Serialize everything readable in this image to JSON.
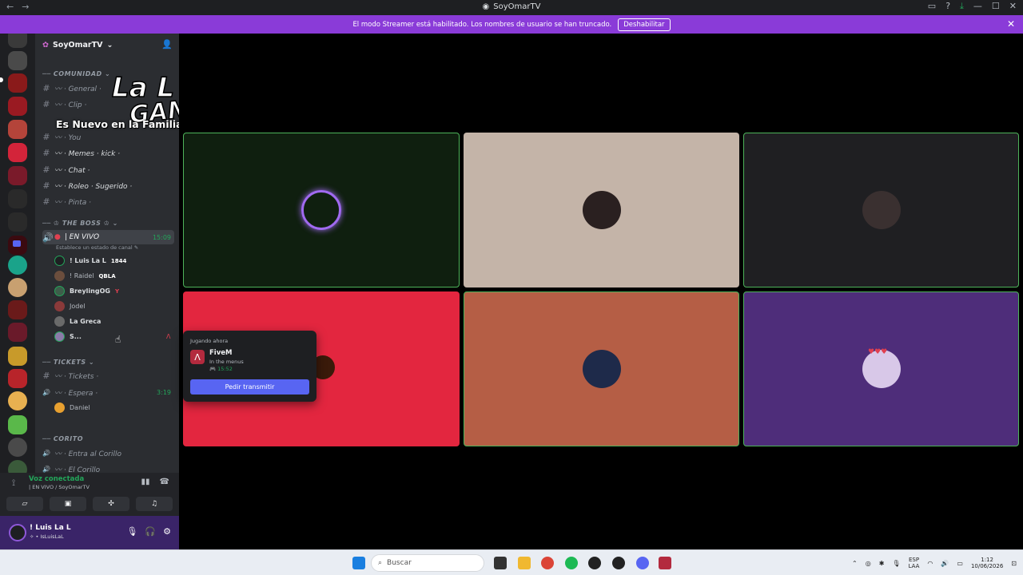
{
  "window": {
    "title": "SoyOmarTV",
    "nav_back": "←",
    "nav_forward": "→",
    "controls": [
      "▭",
      "?",
      "⤓",
      "—",
      "☐",
      "✕"
    ]
  },
  "streamer_banner": {
    "text": "El modo Streamer está habilitado. Los nombres de usuario se han truncado.",
    "button": "Deshabilitar",
    "close": "✕"
  },
  "server": {
    "name": "SoyOmarTV",
    "chevron": "⌄"
  },
  "overlay": {
    "line1": "La L",
    "line2": "GANG",
    "line3": "Es Nuevo en la Familia!"
  },
  "categories": {
    "comunidad": "COMUNIDAD",
    "the_boss": "♔ THE BOSS ♔",
    "tickets": "TICKETS",
    "corito": "CORITO"
  },
  "channels": [
    {
      "name": "〰 · General ·",
      "icon": "#"
    },
    {
      "name": "〰 · Clip ·",
      "icon": "#"
    },
    {
      "name": "〰 · You",
      "icon": "#"
    },
    {
      "name": "〰 · Memes · kick ·",
      "icon": "#"
    },
    {
      "name": "〰 · Chat ·",
      "icon": "#"
    },
    {
      "name": "〰 · Roleo · Sugerido ·",
      "icon": "#"
    },
    {
      "name": "〰 · Pinta ·",
      "icon": "#"
    }
  ],
  "live_channel": {
    "name": "| EN VIVO",
    "time": "15:09",
    "status": "Establece un estado de canal"
  },
  "voice_users": [
    {
      "name": "! Luis La L",
      "badge": "1844",
      "color": "#1e1f22"
    },
    {
      "name": "! Raidel",
      "badge": "QBLA",
      "color": "#6b4e3d"
    },
    {
      "name": "BreylingOG",
      "badge": "Y",
      "color": "#3e5d4a"
    },
    {
      "name": "Jodel",
      "badge": "",
      "color": "#8a3a3a"
    },
    {
      "name": "La Greca",
      "badge": "",
      "color": "#6a6a6a"
    },
    {
      "name": "S...",
      "badge": "",
      "color": "#8a7aa8"
    }
  ],
  "tickets_channels": [
    {
      "name": "〰 · Tickets ·",
      "icon": "#"
    },
    {
      "name": "〰 · Espera ·",
      "icon": "🔊",
      "time": "3:19"
    }
  ],
  "tickets_user": "Daniel",
  "corito_channels": [
    {
      "name": "〰 · Entra al Corillo",
      "icon": "🔊"
    },
    {
      "name": "〰 · El Corillo",
      "icon": "🔊"
    }
  ],
  "voice_panel": {
    "status": "Voz conectada",
    "location": "| EN VIVO / SoyOmarTV"
  },
  "user_panel": {
    "name": "! Luis La L",
    "tag": "✧ • IsLuisLaL"
  },
  "activity_popout": {
    "header": "Jugando ahora",
    "game": "FiveM",
    "state": "In the menus",
    "elapsed": "15:52",
    "button": "Pedir transmitir"
  },
  "tiles": [
    {
      "bg": "#0f1f0f",
      "speaking": true,
      "avatar": "ring"
    },
    {
      "bg": "#c4b4a8",
      "speaking": false,
      "avatar": "#2a2020"
    },
    {
      "bg": "#1f1f22",
      "speaking": true,
      "avatar": "#3a3030"
    },
    {
      "bg": "#e3263f",
      "speaking": false,
      "avatar": "#3a1a0a"
    },
    {
      "bg": "#b55e45",
      "speaking": true,
      "avatar": "#1e2a4a"
    },
    {
      "bg": "#4e2d7a",
      "speaking": true,
      "avatar": "#d8c8e8"
    }
  ],
  "taskbar": {
    "search_placeholder": "Buscar",
    "lang_top": "ESP",
    "lang_bottom": "LAA",
    "time": "1:12",
    "date": "10/06/2026"
  }
}
